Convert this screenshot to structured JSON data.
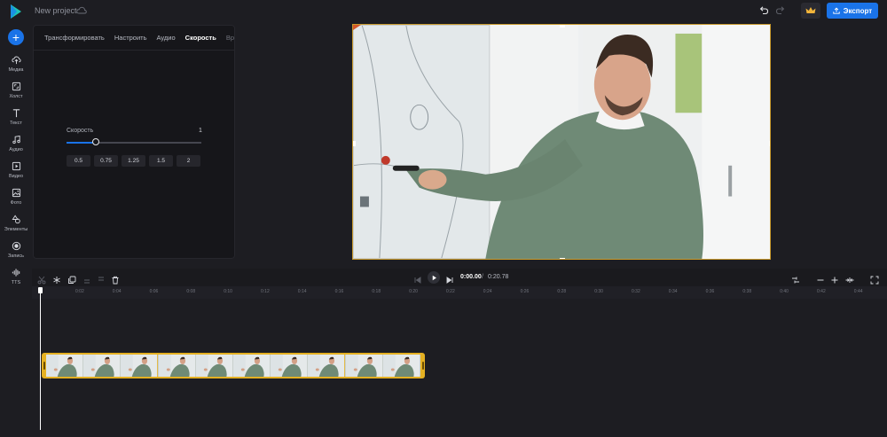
{
  "header": {
    "project_title": "New project",
    "export_label": "Экспорт"
  },
  "sidebar": {
    "add_label": "+",
    "items": [
      {
        "label": "Медиа",
        "icon": "upload-icon"
      },
      {
        "label": "Холст",
        "icon": "canvas-icon"
      },
      {
        "label": "Текст",
        "icon": "text-icon"
      },
      {
        "label": "Аудио",
        "icon": "music-icon"
      },
      {
        "label": "Видео",
        "icon": "video-icon"
      },
      {
        "label": "Фото",
        "icon": "photo-icon"
      },
      {
        "label": "Элементы",
        "icon": "shapes-icon"
      },
      {
        "label": "Запись",
        "icon": "record-icon"
      },
      {
        "label": "TTS",
        "icon": "waveform-icon"
      }
    ]
  },
  "panel": {
    "tabs": [
      {
        "label": "Трансформировать",
        "active": false
      },
      {
        "label": "Настроить",
        "active": false
      },
      {
        "label": "Аудио",
        "active": false
      },
      {
        "label": "Скорость",
        "active": true
      },
      {
        "label": "Время",
        "active": false
      }
    ],
    "speed_label": "Скорость",
    "speed_value": "1",
    "slider_fraction": 0.22,
    "presets": [
      "0.5",
      "0.75",
      "1.25",
      "1.5",
      "2"
    ]
  },
  "timeline": {
    "current_time": "0:00.00",
    "separator": "/",
    "total_time": "0:20.78",
    "ruler_ticks": [
      "0:02",
      "0:04",
      "0:06",
      "0:08",
      "0:10",
      "0:12",
      "0:14",
      "0:16",
      "0:18",
      "0:20",
      "0:22",
      "0:24",
      "0:26",
      "0:28",
      "0:30",
      "0:32",
      "0:34",
      "0:36",
      "0:38",
      "0:40",
      "0:42",
      "0:44"
    ]
  },
  "colors": {
    "accent": "#1a73e8",
    "clip": "#e4b022",
    "background": "#1d1d22"
  }
}
